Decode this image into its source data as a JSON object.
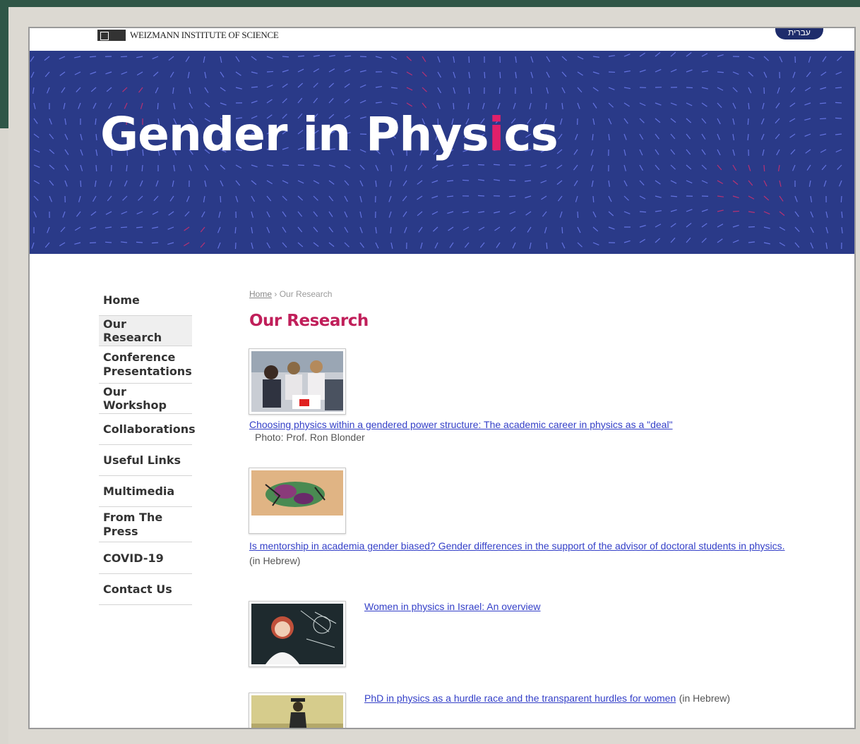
{
  "header": {
    "logo_text": "WEIZMANN INSTITUTE OF SCIENCE",
    "lang_button": "עברית"
  },
  "hero": {
    "title_part1": "Gender in Phys",
    "title_accent": "i",
    "title_part2": "cs"
  },
  "sidebar": {
    "items": [
      {
        "label": "Home"
      },
      {
        "label": "Our Research"
      },
      {
        "label": "Conference Presentations"
      },
      {
        "label": "Our Workshop"
      },
      {
        "label": "Collaborations"
      },
      {
        "label": "Useful Links"
      },
      {
        "label": "Multimedia"
      },
      {
        "label": "From The Press"
      },
      {
        "label": "COVID-19"
      },
      {
        "label": "Contact Us"
      }
    ]
  },
  "breadcrumb": {
    "home": "Home",
    "separator": "›",
    "current": "Our Research"
  },
  "main": {
    "title": "Our Research",
    "items": [
      {
        "link": "Choosing physics within a gendered power structure: The academic career in physics as a \"deal\"",
        "caption": "Photo: Prof. Ron Blonder"
      },
      {
        "link": "Is mentorship in academia gender biased? Gender differences in the support of the advisor of doctoral students in physics.",
        "caption": "(in Hebrew)"
      },
      {
        "link": "Women in physics in Israel: An overview"
      },
      {
        "link": "PhD in physics as a hurdle race and the transparent hurdles for women",
        "suffix": "(in Hebrew)"
      }
    ]
  },
  "colors": {
    "hero_bg": "#2a3a88",
    "accent": "#c01f5a",
    "link": "#3440c8"
  }
}
